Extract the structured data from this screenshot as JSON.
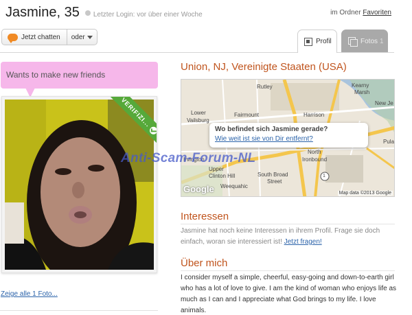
{
  "header": {
    "name": "Jasmine, 35",
    "last_login": "Letzter Login: vor über einer Woche",
    "folder_prefix": "im Ordner",
    "folder_link": "Favoriten"
  },
  "actions": {
    "chat_label": "Jetzt chatten",
    "or_label": "oder"
  },
  "tabs": [
    {
      "label": "Profil",
      "active": true
    },
    {
      "label": "Fotos",
      "count": "1",
      "active": false
    }
  ],
  "status_message": "Wants to make new friends",
  "photo": {
    "verified_label": "VERIFIZI...",
    "show_all_link": "Zeige alle 1 Foto..."
  },
  "location": {
    "title": "Union, NJ, Vereinigte Staaten (USA)",
    "popup_title": "Wo befindet sich Jasmine gerade?",
    "popup_link": "Wie weit ist sie von Dir entfernt?",
    "map_labels": [
      "Rutley",
      "Kearny",
      "Marsh",
      "Lower",
      "Vailsburg",
      "Fairmount",
      "Harrison",
      "New Je",
      "Irvington",
      "Upper",
      "Clinton Hill",
      "North",
      "Ironbound",
      "South Broad",
      "Street",
      "Weequahic",
      "Pula"
    ],
    "map_credit": "Map data ©2013 Google",
    "google_logo": "Google",
    "highway_shield": "1"
  },
  "watermark": "Anti-Scam-Forum-NL",
  "interests": {
    "title": "Interessen",
    "text": "Jasmine hat noch keine Interessen in ihrem Profil. Frage sie doch einfach, woran sie interessiert ist!",
    "link": "Jetzt fragen!"
  },
  "about": {
    "title": "Über mich",
    "text": "I consider myself a simple, cheerful, easy-going and down-to-earth girl who has a lot of love to give. I am the kind of woman who enjoys life as much as I can and I appreciate what God brings to my life. I love animals."
  },
  "colors": {
    "accent": "#c0541d",
    "link": "#2a62a9",
    "status_bubble": "#f6b7ea",
    "verified": "#56a93a",
    "chat_icon": "#f08a24"
  }
}
